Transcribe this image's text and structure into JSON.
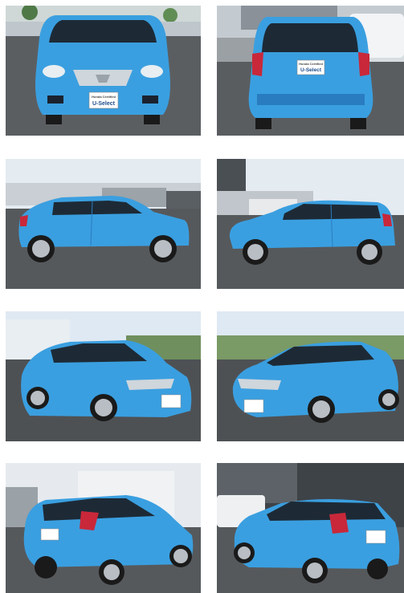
{
  "badge": {
    "small": "Honda Certified",
    "brand": "U-Select"
  },
  "colors": {
    "body": "#3a9fe0",
    "body_dark": "#1f73b8",
    "glass": "#1d2a36",
    "tire": "#1a1a1a",
    "rim": "#b8bec4",
    "asphalt": "#55585c",
    "sky": "#dce6ee"
  },
  "photos": [
    {
      "view": "front",
      "name": "photo-front"
    },
    {
      "view": "rear",
      "name": "photo-rear"
    },
    {
      "view": "side-left",
      "name": "photo-side-left"
    },
    {
      "view": "side-right",
      "name": "photo-side-right"
    },
    {
      "view": "front-left",
      "name": "photo-front-left-quarter"
    },
    {
      "view": "front-right",
      "name": "photo-front-right-quarter"
    },
    {
      "view": "rear-left",
      "name": "photo-rear-left-quarter"
    },
    {
      "view": "rear-right",
      "name": "photo-rear-right-quarter"
    }
  ]
}
